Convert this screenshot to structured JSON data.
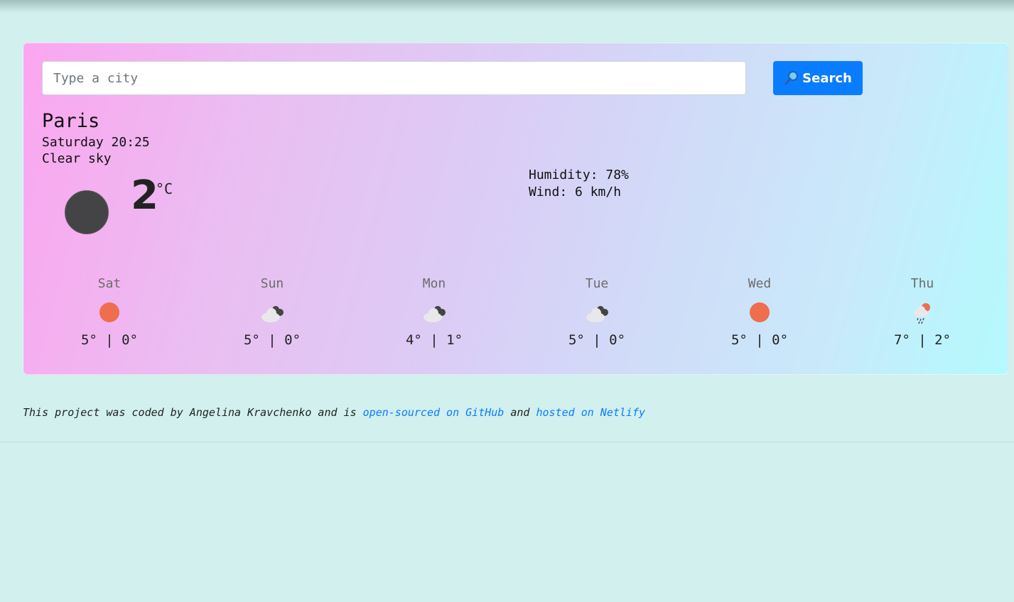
{
  "search": {
    "placeholder": "Type a city",
    "button_label": "Search"
  },
  "current": {
    "city": "Paris",
    "datetime": "Saturday 20:25",
    "description": "Clear sky",
    "temperature": "2",
    "unit": "°C",
    "icon": "moon-icon",
    "humidity": "Humidity: 78%",
    "wind": "Wind: 6 km/h"
  },
  "forecast": [
    {
      "day": "Sat",
      "icon": "sun-icon",
      "temps": "5° | 0°"
    },
    {
      "day": "Sun",
      "icon": "cloud-icon",
      "temps": "5° | 0°"
    },
    {
      "day": "Mon",
      "icon": "cloud-icon",
      "temps": "4° | 1°"
    },
    {
      "day": "Tue",
      "icon": "cloud-icon",
      "temps": "5° | 0°"
    },
    {
      "day": "Wed",
      "icon": "sun-icon",
      "temps": "5° | 0°"
    },
    {
      "day": "Thu",
      "icon": "rain-icon",
      "temps": "7° | 2°"
    }
  ],
  "footer": {
    "prefix": "This project was coded by Angelina Kravchenko and is ",
    "github_link": "open-sourced on GitHub",
    "middle": " and ",
    "netlify_link": "hosted on Netlify"
  },
  "colors": {
    "accent": "#0a7cff",
    "background": "#d1f0ee"
  }
}
